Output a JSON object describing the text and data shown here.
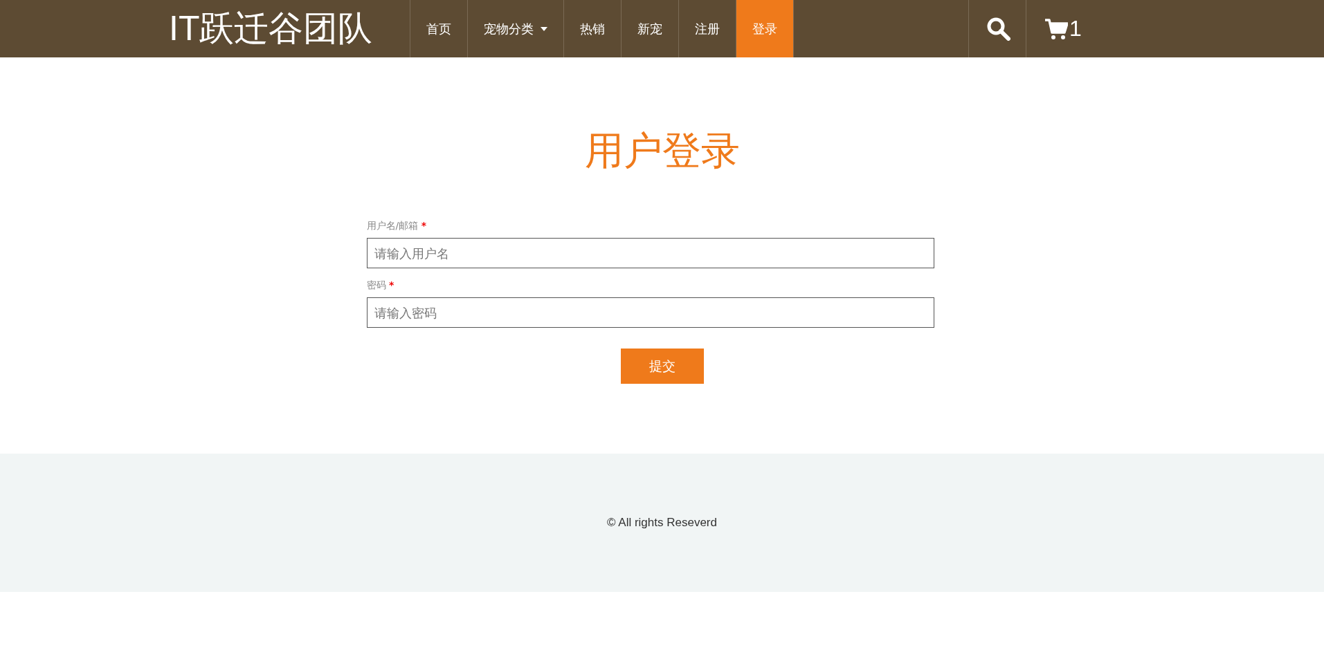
{
  "header": {
    "logo": "IT跃迁谷团队",
    "nav": [
      {
        "label": "首页",
        "selected": false,
        "dropdown": false
      },
      {
        "label": "宠物分类",
        "selected": false,
        "dropdown": true
      },
      {
        "label": "热销",
        "selected": false,
        "dropdown": false
      },
      {
        "label": "新宠",
        "selected": false,
        "dropdown": false
      },
      {
        "label": "注册",
        "selected": false,
        "dropdown": false
      },
      {
        "label": "登录",
        "selected": true,
        "dropdown": false
      }
    ],
    "cart_count": "1"
  },
  "form": {
    "title": "用户登录",
    "fields": [
      {
        "label": "用户名/邮箱",
        "required_mark": "*",
        "placeholder": "请输入用户名"
      },
      {
        "label": "密码",
        "required_mark": "*",
        "placeholder": "请输入密码"
      }
    ],
    "submit": "提交"
  },
  "footer": {
    "text": "© All rights Reseverd"
  }
}
